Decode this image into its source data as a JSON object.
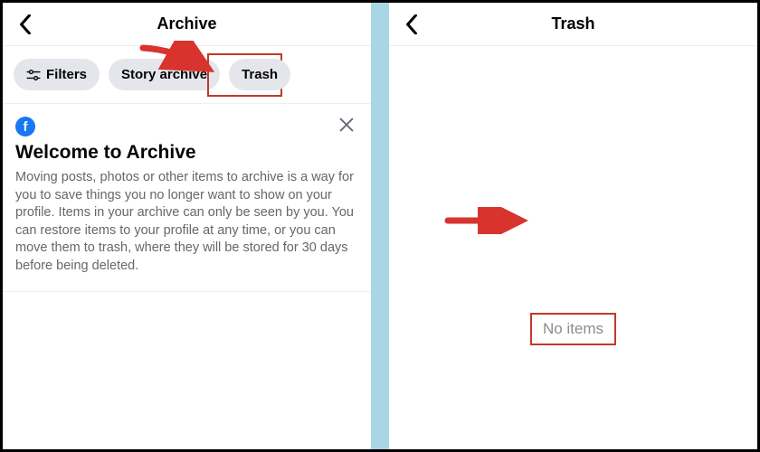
{
  "left": {
    "title": "Archive",
    "chips": {
      "filters": "Filters",
      "story_archive": "Story archive",
      "trash": "Trash"
    },
    "info": {
      "logo_letter": "f",
      "title": "Welcome to Archive",
      "body": "Moving posts, photos or other items to archive is a way for you to save things you no longer want to show on your profile. Items in your archive can only be seen by you. You can restore items to your profile at any time, or you can move them to trash, where they will be stored for 30 days before being deleted."
    }
  },
  "right": {
    "title": "Trash",
    "empty_label": "No items"
  }
}
